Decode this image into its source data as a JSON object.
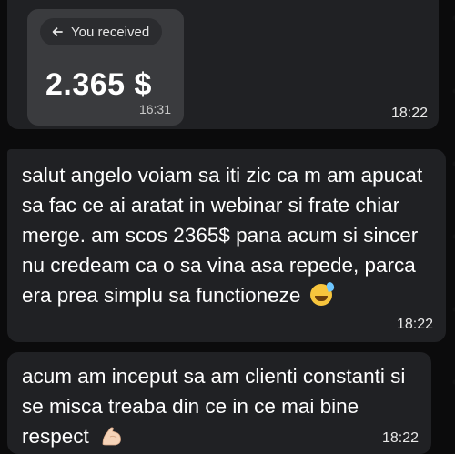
{
  "messages": [
    {
      "card": {
        "chip_label": "You received",
        "amount": "2.365 $",
        "time": "16:31"
      },
      "time": "18:22"
    },
    {
      "text": "salut angelo voiam sa iti zic ca m am apucat sa fac ce ai aratat in webinar si frate chiar merge. am scos 2365$ pana acum si sincer nu credeam ca o sa vina asa repede, parca era prea simplu sa functioneze",
      "emoji": "grinning-face-with-sweat",
      "time": "18:22"
    },
    {
      "text": "acum am inceput sa am clienti constanti si se misca treaba din ce in ce mai bine respect",
      "emoji": "flexed-biceps",
      "time": "18:22"
    }
  ],
  "colors": {
    "background": "#0b0b0c",
    "bubble": "#202124",
    "card": "#3a3b3e"
  }
}
